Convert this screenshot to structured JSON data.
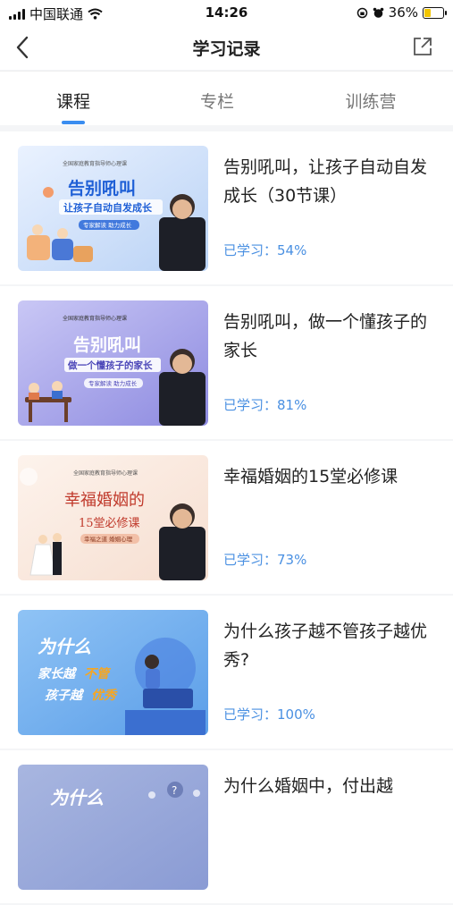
{
  "status_bar": {
    "carrier": "中国联通",
    "time": "14:26",
    "battery": "36%"
  },
  "nav": {
    "title": "学习记录"
  },
  "tabs": [
    {
      "label": "课程",
      "active": true
    },
    {
      "label": "专栏",
      "active": false
    },
    {
      "label": "训练营",
      "active": false
    }
  ],
  "courses": [
    {
      "title": "告别吼叫，让孩子自动自发成长（30节课）",
      "progress": "已学习：54%",
      "thumb": {
        "headline": "告别吼叫",
        "sub": "让孩子自动自发成长",
        "tag": "专家解读 助力成长",
        "top": "全国家庭教育指导师心理课",
        "bg1": "#eaf2ff",
        "bg2": "#b9d2f5"
      }
    },
    {
      "title": "告别吼叫，做一个懂孩子的家长",
      "progress": "已学习：81%",
      "thumb": {
        "headline": "告别吼叫",
        "sub": "做一个懂孩子的家长",
        "tag": "专家解读 助力成长",
        "top": "全国家庭教育指导师心理课",
        "bg1": "#c9c7f5",
        "bg2": "#8d8ae0"
      }
    },
    {
      "title": "幸福婚姻的15堂必修课",
      "progress": "已学习：73%",
      "thumb": {
        "headline": "幸福婚姻的",
        "sub": "15堂必修课",
        "tag": "幸福之道 婚姻心理",
        "top": "全国家庭教育指导师心理课",
        "bg1": "#fdf3ec",
        "bg2": "#f6ded0"
      }
    },
    {
      "title": "为什么孩子越不管孩子越优秀?",
      "progress": "已学习：100%",
      "thumb": {
        "headline": "为什么",
        "sub1a": "家长越",
        "sub1b": "不管",
        "sub2a": "孩子越",
        "sub2b": "优秀",
        "bg1": "#8fc3f5",
        "bg2": "#5b9ee8"
      }
    },
    {
      "title": "为什么婚姻中，付出越",
      "progress": "",
      "thumb": {
        "headline": "为什么",
        "bg1": "#a8b6e0",
        "bg2": "#8a9bd4"
      }
    }
  ]
}
